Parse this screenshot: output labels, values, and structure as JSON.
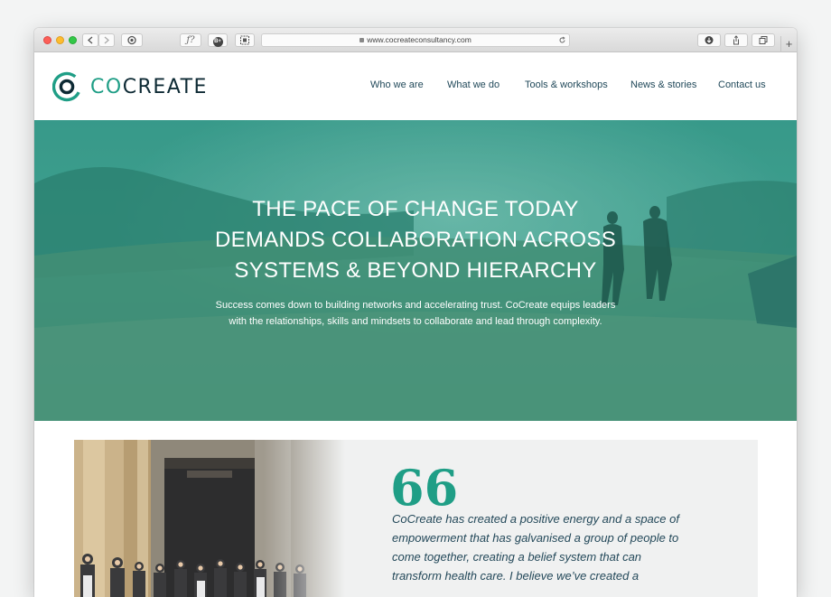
{
  "browser": {
    "url": "www.cocreateconsultancy.com",
    "share_glyph": "ƒ?",
    "extension_glyph": "B+",
    "new_tab_glyph": "+"
  },
  "site": {
    "logo_co": "CO",
    "logo_create": "CREATE",
    "nav": [
      "Who we are",
      "What we do",
      "Tools & workshops",
      "News & stories",
      "Contact us"
    ]
  },
  "hero": {
    "heading_lines": [
      "THE PACE OF CHANGE TODAY",
      "DEMANDS COLLABORATION ACROSS",
      "SYSTEMS & BEYOND HIERARCHY"
    ],
    "sub_lines": [
      "Success comes down to building networks and accelerating trust. CoCreate equips leaders",
      "with the relationships, skills and mindsets to collaborate and lead through complexity."
    ]
  },
  "testimonial": {
    "quote_mark": "66",
    "lines": [
      "CoCreate has created a positive energy and a space of",
      "empowerment that has galvanised a group of people to",
      "come together, creating a belief system that can",
      "transform health care. I believe we’ve created a"
    ]
  },
  "colors": {
    "brand": "#1f9e86",
    "navy": "#0d2a34",
    "nav_text": "#21495a"
  }
}
